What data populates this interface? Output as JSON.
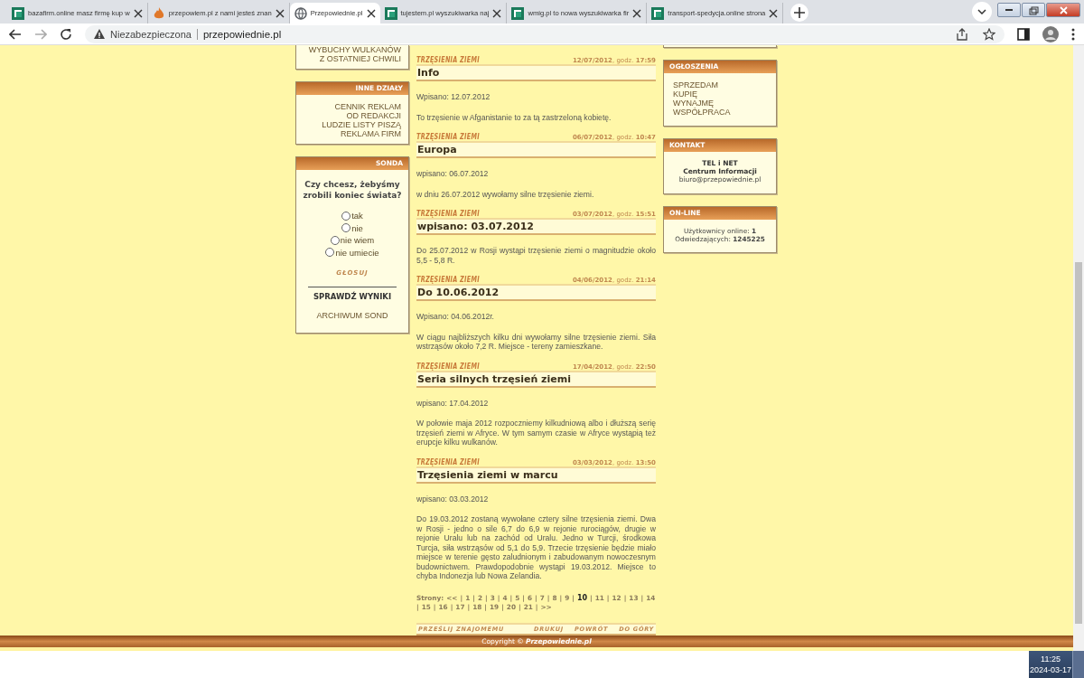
{
  "browser": {
    "tabs": [
      {
        "title": "bazafirm.online masz firmę kup w",
        "kind": "green",
        "selected": false
      },
      {
        "title": "przepowiem.pl z nami jesteś znan",
        "kind": "flame",
        "selected": false
      },
      {
        "title": "Przepowiednie.pl",
        "kind": "globe",
        "selected": true
      },
      {
        "title": "tujestem.pl wyszukiwarka naj",
        "kind": "green",
        "selected": false
      },
      {
        "title": "wmig.pl to nowa wyszukiwarka fir",
        "kind": "green",
        "selected": false
      },
      {
        "title": "transport-spedycja.online strona",
        "kind": "green",
        "selected": false
      }
    ],
    "security": "Niezabezpieczona",
    "url": "przepowiednie.pl"
  },
  "left_sidebar": {
    "boxes": [
      {
        "items": [
          "WYBUCHY WULKANÓW",
          "Z OSTATNIEJ CHWILI"
        ]
      },
      {
        "title": "INNE DZIAŁY",
        "items": [
          "CENNIK REKLAM",
          "OD REDAKCJI",
          "LUDZIE LISTY PISZĄ",
          "REKLAMA FIRM"
        ]
      }
    ],
    "poll": {
      "title": "SONDA",
      "question": "Czy chcesz, żebyśmy zrobili koniec świata?",
      "options": [
        {
          "label": "tak",
          "selected": false
        },
        {
          "label": "nie",
          "selected": false
        },
        {
          "label": "nie wiem",
          "selected": false
        },
        {
          "label": "nie umiecie",
          "selected": false
        }
      ],
      "vote": "GŁOSUJ",
      "results": "SPRAWDŹ WYNIKI",
      "archive": "ARCHIWUM SOND"
    }
  },
  "articles": [
    {
      "category": "TRZĘSIENIA ZIEMI",
      "date": "**12/07/2012**, godz. **17:59**",
      "title": "Info",
      "paragraphs": [
        "Wpisano: 12.07.2012",
        "To trzęsienie w Afganistanie to za tą zastrzeloną kobietę."
      ]
    },
    {
      "category": "TRZĘSIENIA ZIEMI",
      "date": "**06/07/2012**, godz. **10:47**",
      "title": "Europa",
      "paragraphs": [
        "wpisano: 06.07.2012",
        "w dniu 26.07.2012 wywołamy silne trzęsienie ziemi."
      ]
    },
    {
      "category": "TRZĘSIENIA ZIEMI",
      "date": "**03/07/2012**, godz. **15:51**",
      "title": "wpisano: 03.07.2012",
      "paragraphs": [
        "Do 25.07.2012 w Rosji wystąpi trzęsienie ziemi o magnitudzie około 5,5 - 5,8 R."
      ]
    },
    {
      "category": "TRZĘSIENIA ZIEMI",
      "date": "**04/06/2012**, godz. **21:14**",
      "title": "Do 10.06.2012",
      "paragraphs": [
        "Wpisano: 04.06.2012r.",
        "W ciągu najbliższych kilku dni wywołamy silne trzęsienie ziemi. Siła wstrząsów około 7,2 R. Miejsce - tereny zamieszkane."
      ]
    },
    {
      "category": "TRZĘSIENIA ZIEMI",
      "date": "**17/04/2012**, godz. **22:50**",
      "title": "Seria silnych trzęsień ziemi",
      "paragraphs": [
        "wpisano: 17.04.2012",
        "W połowie maja 2012 rozpoczniemy kilkudniową albo i dłuższą serię trzęsień ziemi w Afryce. W tym samym czasie w Afryce wystąpią też erupcje kilku wulkanów."
      ]
    },
    {
      "category": "TRZĘSIENIA ZIEMI",
      "date": "**03/03/2012**, godz. **13:50**",
      "title": "Trzęsienia ziemi w marcu",
      "paragraphs": [
        "wpisano: 03.03.2012",
        "Do 19.03.2012 zostaną wywołane cztery silne trzęsienia ziemi. Dwa w Rosji - jedno o sile 6,7 do 6,9 w rejonie rurociągów, drugie w rejonie Uralu lub na zachód od Uralu. Jedno w Turcji, środkowa Turcja, siła wstrząsów od 5,1 do 5,9. Trzecie trzęsienie będzie miało miejsce w terenie gęsto zaludnionym i zabudowanym nowoczesnym budownictwem. Prawdopodobnie wystąpi 19.03.2012. Miejsce to chyba Indonezja lub Nowa Zelandia."
      ]
    }
  ],
  "pagination": {
    "label": "Strony:",
    "separator": "|",
    "pages": [
      {
        "label": "<<",
        "selected": false
      },
      {
        "label": "1",
        "selected": false
      },
      {
        "label": "2",
        "selected": false
      },
      {
        "label": "3",
        "selected": false
      },
      {
        "label": "4",
        "selected": false
      },
      {
        "label": "5",
        "selected": false
      },
      {
        "label": "6",
        "selected": false
      },
      {
        "label": "7",
        "selected": false
      },
      {
        "label": "8",
        "selected": false
      },
      {
        "label": "9",
        "selected": false
      },
      {
        "label": "10",
        "selected": true
      },
      {
        "label": "11",
        "selected": false
      },
      {
        "label": "12",
        "selected": false
      },
      {
        "label": "13",
        "selected": false
      },
      {
        "label": "14",
        "selected": false
      },
      {
        "label": "15",
        "selected": false
      },
      {
        "label": "16",
        "selected": false
      },
      {
        "label": "17",
        "selected": false
      },
      {
        "label": "18",
        "selected": false
      },
      {
        "label": "19",
        "selected": false
      },
      {
        "label": "20",
        "selected": false
      },
      {
        "label": "21",
        "selected": false
      },
      {
        "label": ">>",
        "selected": false
      }
    ]
  },
  "article_actions": {
    "share": "PRZEŚLIJ ZNAJOMEMU",
    "links": [
      "DRUKUJ",
      "POWRÓT",
      "DO GÓRY"
    ]
  },
  "right_sidebar": {
    "ads": {
      "title": "OGŁOSZENIA",
      "items": [
        "SPRZEDAM",
        "KUPIĘ",
        "WYNAJMĘ",
        "WSPÓŁPRACA"
      ]
    },
    "contact": {
      "title": "KONTAKT",
      "lines": [
        "TEL i NET",
        "Centrum Informacji"
      ],
      "email": "biuro@przepowiednie.pl"
    },
    "online": {
      "title": "ON-LINE",
      "lines": [
        "Użytkownicy online: **1**",
        "Odwiedzających: **1245225**"
      ]
    }
  },
  "footer": {
    "copyright": "Copyright © **Przepowiednie.pl**"
  },
  "taskbar": {
    "time": "11:25",
    "date": "2024-03-17"
  }
}
